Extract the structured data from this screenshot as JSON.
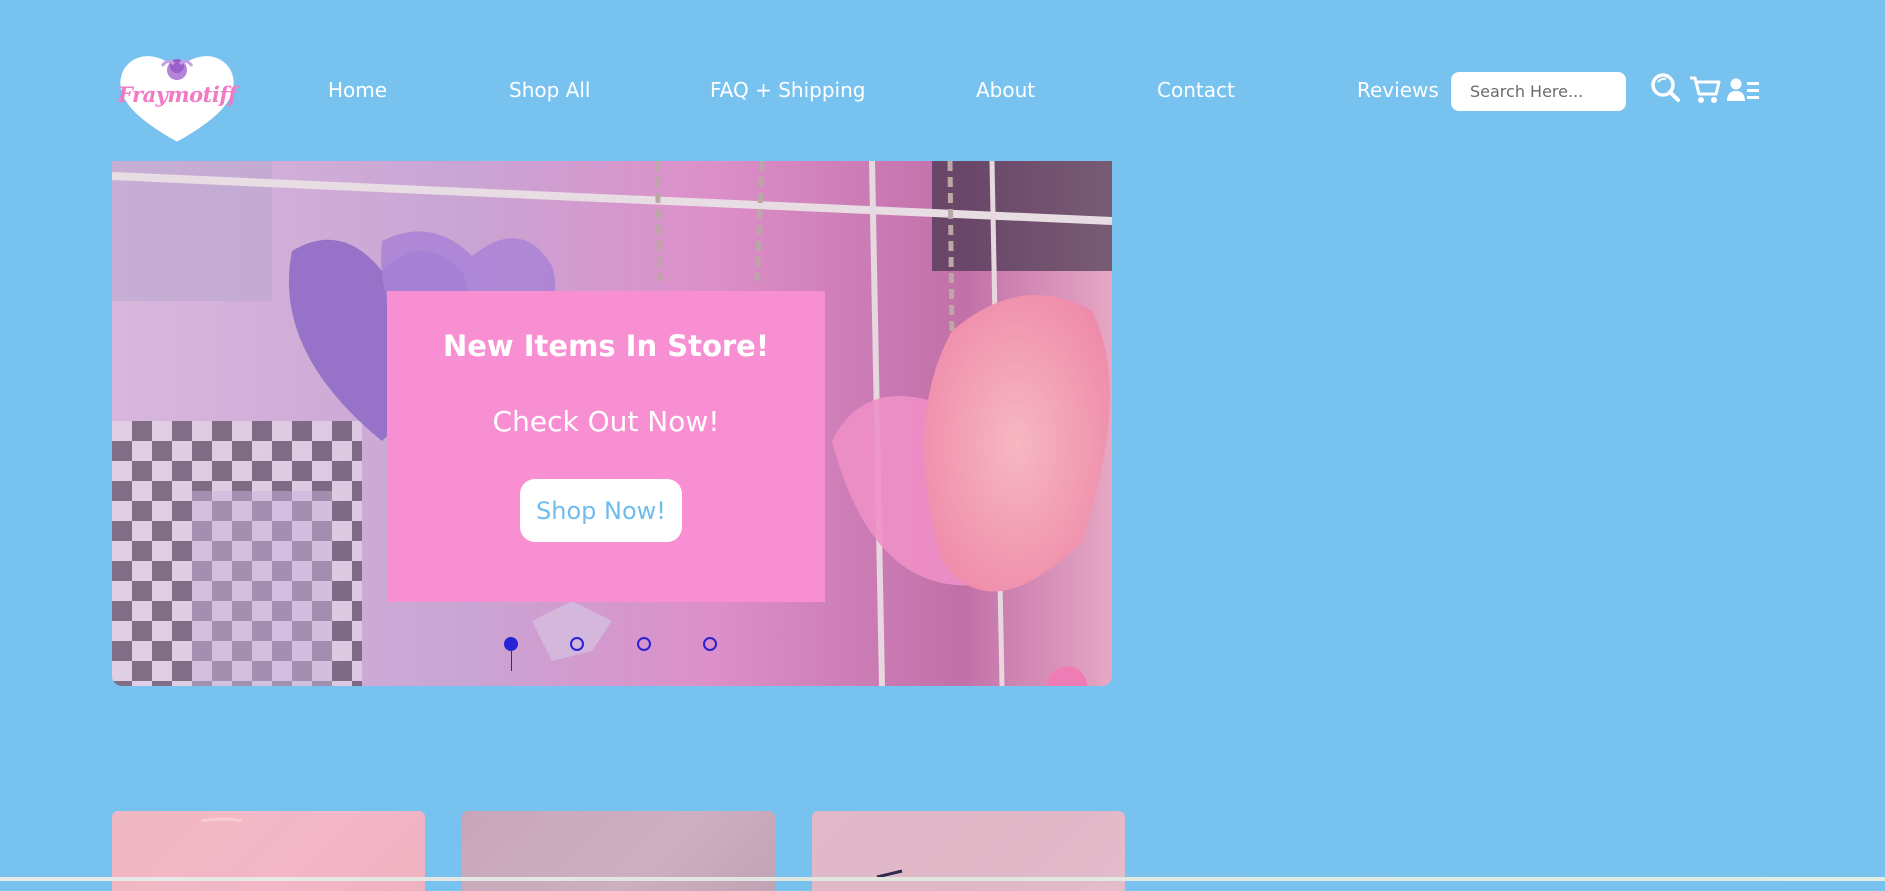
{
  "brand": {
    "logo_text": "Fraymotiff"
  },
  "nav": {
    "items": [
      {
        "label": "Home"
      },
      {
        "label": "Shop All"
      },
      {
        "label": "FAQ + Shipping"
      },
      {
        "label": "About"
      },
      {
        "label": "Contact"
      },
      {
        "label": "Reviews"
      }
    ]
  },
  "search": {
    "placeholder": "Search Here..."
  },
  "icons": [
    "search-icon",
    "cart-icon",
    "account-icon"
  ],
  "hero": {
    "headline": "New Items In Store!",
    "subheadline": "Check Out Now!",
    "cta_label": "Shop Now!",
    "slide_count": 4,
    "active_slide": 1
  },
  "colors": {
    "background": "#78c2ef",
    "card": "#f88fd2",
    "cta_text": "#6fbcee",
    "dot": "#2a23d6"
  }
}
